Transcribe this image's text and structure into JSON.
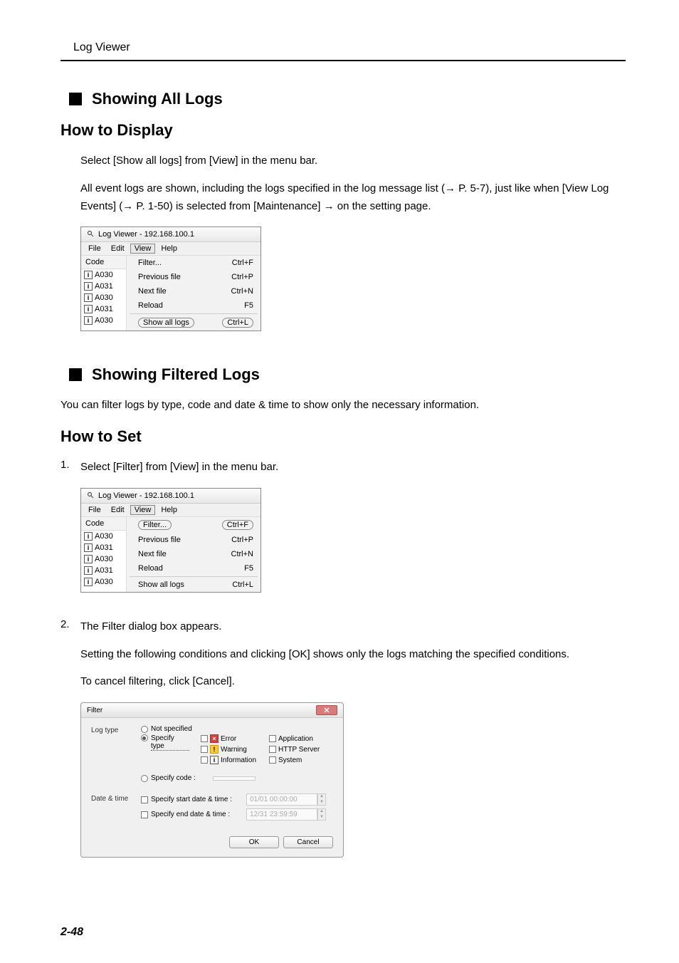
{
  "header": {
    "title": "Log Viewer"
  },
  "s1": {
    "title": "Showing All Logs",
    "sub": "How to Display",
    "p1": "Select [Show all logs] from [View] in the menu bar.",
    "p2a": "All event logs are shown, including the logs specified in the log message list (",
    "p2ref1": "→ P. 5-7",
    "p2b": "), just like when [",
    "p2bold1": "View Log Events",
    "p2c": "] (",
    "p2ref2": "→ P. 1-50",
    "p2d": ") is selected from [",
    "p2bold2": "Maintenance",
    "p2e": "] → on the setting page."
  },
  "s2": {
    "title": "Showing Filtered Logs",
    "intro": "You can filter logs by type, code and date & time to show only the necessary information.",
    "sub": "How to Set",
    "step1": "Select [Filter] from [View] in the menu bar.",
    "step2a": "The Filter dialog box appears.",
    "step2b": "Setting the following conditions and clicking [OK] shows only the logs matching the specified conditions.",
    "step2c_a": "To cancel filtering, click [",
    "step2c_bold": "Cancel",
    "step2c_b": "]."
  },
  "menu": {
    "title": "Log Viewer - 192.168.100.1",
    "file": "File",
    "edit": "Edit",
    "view": "View",
    "help": "Help",
    "code": "Code",
    "rows": [
      "A030",
      "A031",
      "A030",
      "A031",
      "A030"
    ],
    "items": [
      {
        "label": "Filter...",
        "sc": "Ctrl+F"
      },
      {
        "label": "Previous file",
        "sc": "Ctrl+P"
      },
      {
        "label": "Next file",
        "sc": "Ctrl+N"
      },
      {
        "label": "Reload",
        "sc": "F5"
      },
      {
        "label": "Show all logs",
        "sc": "Ctrl+L"
      }
    ]
  },
  "dialog": {
    "title": "Filter",
    "logtype": "Log type",
    "r1": "Not specified",
    "r2": "Specify type",
    "t_error": "Error",
    "t_warning": "Warning",
    "t_info": "Information",
    "t_app": "Application",
    "t_http": "HTTP Server",
    "t_sys": "System",
    "r3": "Specify code :",
    "datetime": "Date & time",
    "cbstart": "Specify start date & time :",
    "cbend": "Specify end date & time :",
    "startval": "01/01 00:00:00",
    "endval": "12/31 23:59:59",
    "ok": "OK",
    "cancel": "Cancel"
  },
  "pagenum": "2-48"
}
